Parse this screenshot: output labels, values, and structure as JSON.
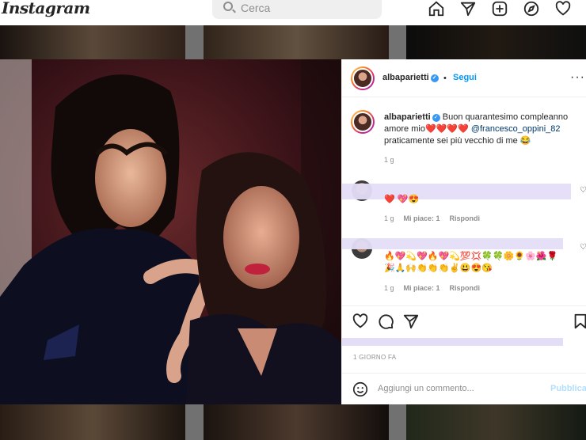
{
  "app": {
    "logo": "Instagram"
  },
  "search": {
    "placeholder": "Cerca"
  },
  "nav": {
    "icons": [
      "home-icon",
      "direct-icon",
      "new-post-icon",
      "explore-icon",
      "activity-icon"
    ]
  },
  "post": {
    "username": "albaparietti",
    "verified": true,
    "dot": "•",
    "follow_label": "Segui",
    "more": "···",
    "caption": {
      "username": "albaparietti",
      "text_before": "Buon quarantesimo compleanno amore mio",
      "hearts": "❤️❤️❤️❤️",
      "mention": "@francesco_oppini_82",
      "text_after": "praticamente sei più vecchio di me 😂"
    },
    "caption_time": "1 g",
    "comments": [
      {
        "text": "❤️ 💖😍",
        "time": "1 g",
        "likes": "Mi piace: 1",
        "reply": "Rispondi"
      },
      {
        "text": "🔥💖💫💖🔥💖💫💯💢🍀🍀🌼🌻🌸🌺🌹🎉🙏🙌👏👏👏✌️😃😍😘",
        "time": "1 g",
        "likes": "Mi piace: 1",
        "reply": "Rispondi"
      }
    ],
    "time_ago": "1 GIORNO FA",
    "add_comment_placeholder": "Aggiungi un commento...",
    "publish_label": "Pubblica"
  },
  "colors": {
    "accent": "#0095f6",
    "heart": "#ed2f3c",
    "redaction": "#e4ddf7"
  }
}
